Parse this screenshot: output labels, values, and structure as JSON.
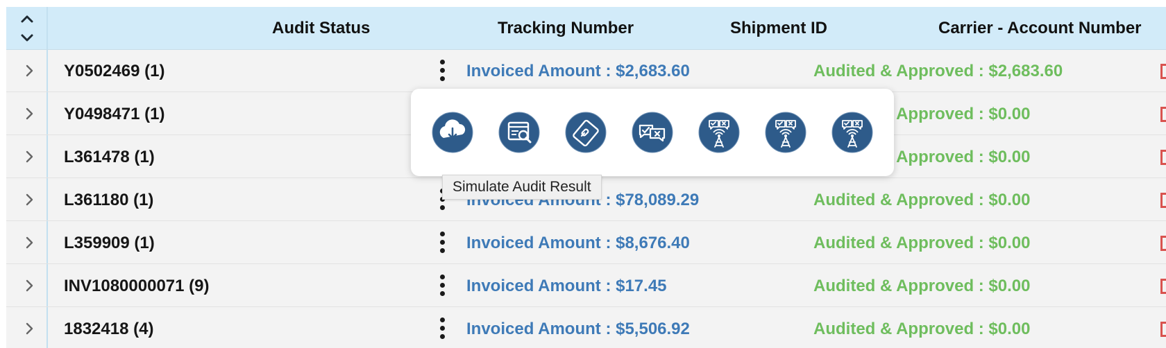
{
  "header": {
    "sort_icon": "sort-up-down-icon",
    "columns": [
      "Audit Status",
      "Tracking Number",
      "Shipment ID",
      "Carrier - Account Number"
    ]
  },
  "rows": [
    {
      "id": "Y0502469 (1)",
      "invoiced": "Invoiced Amount : $2,683.60",
      "audited": "Audited & Approved : $2,683.60"
    },
    {
      "id": "Y0498471 (1)",
      "invoiced": "",
      "audited": "Audited & Approved : $0.00"
    },
    {
      "id": "L361478 (1)",
      "invoiced": "",
      "audited": "Audited & Approved : $0.00"
    },
    {
      "id": "L361180 (1)",
      "invoiced": "Invoiced Amount : $78,089.29",
      "audited": "Audited & Approved : $0.00"
    },
    {
      "id": "L359909 (1)",
      "invoiced": "Invoiced Amount : $8,676.40",
      "audited": "Audited & Approved : $0.00"
    },
    {
      "id": "INV1080000071 (9)",
      "invoiced": "Invoiced Amount : $17.45",
      "audited": "Audited & Approved : $0.00"
    },
    {
      "id": "1832418 (4)",
      "invoiced": "Invoiced Amount : $5,506.92",
      "audited": "Audited & Approved : $0.00"
    }
  ],
  "popover": {
    "actions": [
      "cloud-download-icon",
      "browser-search-icon",
      "link-icon",
      "chat-check-x-icon",
      "tower-check-x-icon",
      "tower-check-x-icon",
      "tower-check-x-icon"
    ]
  },
  "tooltip": {
    "text": "Simulate Audit Result"
  },
  "colors": {
    "header_bg": "#d2ebf9",
    "row_bg": "#f3f3f3",
    "invoiced_text": "#3e7ab7",
    "audited_text": "#6ebd5d",
    "action_circle": "#2e5b8a",
    "status_red": "#d9534f"
  }
}
